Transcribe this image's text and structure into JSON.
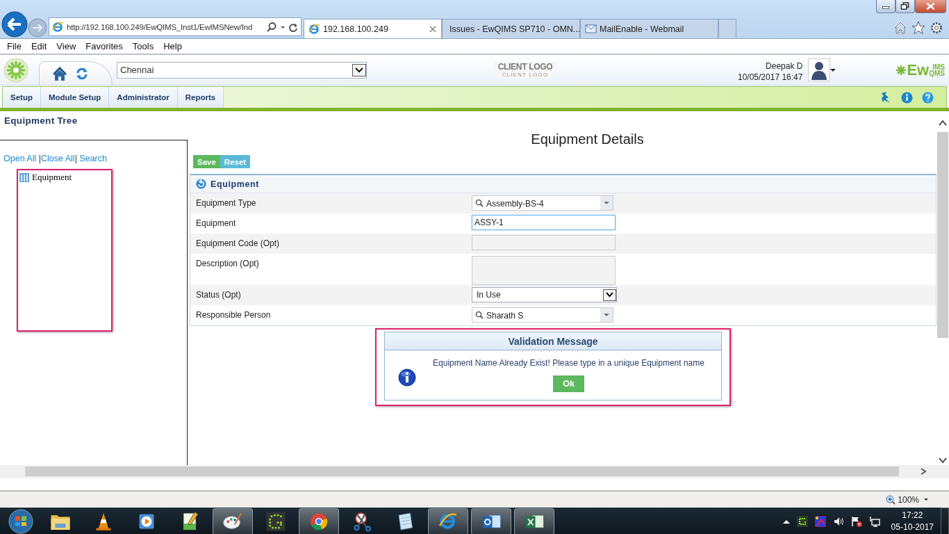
{
  "browser": {
    "address": "http://192.168.100.249/EwQIMS_Inst1/EwIMSNew/Ind",
    "tabs": [
      {
        "label": "192.168.100.249",
        "selected": true,
        "kind": "ie"
      },
      {
        "label": "Issues - EwQIMS SP710 - OMN...",
        "selected": false,
        "kind": "gauge"
      },
      {
        "label": "MailEnable - Webmail",
        "selected": false,
        "kind": "mail"
      }
    ],
    "menu": [
      "File",
      "Edit",
      "View",
      "Favorites",
      "Tools",
      "Help"
    ]
  },
  "header": {
    "location": "Chennai",
    "client_logo": "CLIENT LOGO",
    "client_logo_sub": "CLIENT LOGO",
    "user": "Deepak D",
    "datetime": "10/05/2017 16:47",
    "brand": {
      "main": "Ew",
      "top": "IMS",
      "bottom": "QMS"
    }
  },
  "nav": [
    "Setup",
    "Module Setup",
    "Administrator",
    "Reports"
  ],
  "tree": {
    "title": "Equipment Tree",
    "links": [
      {
        "kind": "link",
        "text": "Open All"
      },
      {
        "kind": "sep",
        "text": " |"
      },
      {
        "kind": "link",
        "text": "Close All"
      },
      {
        "kind": "sep",
        "text": "| "
      },
      {
        "kind": "link",
        "text": "Search"
      }
    ],
    "nodes": [
      {
        "label": "Equipment"
      }
    ]
  },
  "details": {
    "title": "Equipment Details",
    "buttons": [
      {
        "label": "Save",
        "kind": "save"
      },
      {
        "label": "Reset",
        "kind": "reset"
      }
    ],
    "section": "Equipment",
    "fields": [
      {
        "label": "Equipment Type",
        "kind": "lookup",
        "value": "Assembly-BS-4",
        "focused": false
      },
      {
        "label": "Equipment",
        "kind": "text",
        "value": "ASSY-1",
        "focused": true
      },
      {
        "label": "Equipment Code (Opt)",
        "kind": "text",
        "focused": false
      },
      {
        "label": "Description (Opt)",
        "kind": "textarea",
        "focused": false
      },
      {
        "label": "Status (Opt)",
        "kind": "select",
        "value": "In Use",
        "focused": false
      },
      {
        "label": "Responsible Person",
        "kind": "lookup",
        "value": "Sharath S",
        "focused": false
      }
    ]
  },
  "dialog": {
    "title": "Validation Message",
    "message": "Equipment Name Already Exist! Please type in a unique Equipment name",
    "button": "Ok"
  },
  "status_bar": {
    "zoom": "100%"
  },
  "taskbar": {
    "items": [
      {
        "kind": "folder",
        "running": false
      },
      {
        "kind": "cone",
        "running": false
      },
      {
        "kind": "player",
        "running": false
      },
      {
        "kind": "notepadpp",
        "running": false
      },
      {
        "kind": "paint",
        "running": true
      },
      {
        "kind": "dots",
        "running": false
      },
      {
        "kind": "chrome",
        "running": true
      },
      {
        "kind": "scissors",
        "running": false
      },
      {
        "kind": "notepad",
        "running": false
      },
      {
        "kind": "ie",
        "running": true
      },
      {
        "kind": "outlook",
        "running": true
      },
      {
        "kind": "excel",
        "running": true
      }
    ],
    "time": "17:22",
    "date": "05-10-2017"
  }
}
